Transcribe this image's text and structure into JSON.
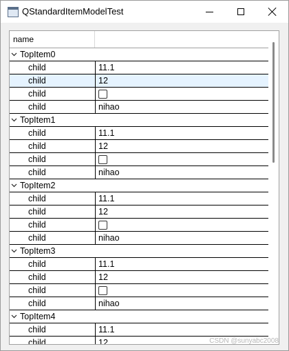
{
  "window": {
    "title": "QStandardItemModelTest"
  },
  "tree": {
    "header": "name",
    "groups": [
      {
        "label": "TopItem0",
        "children": [
          {
            "name": "child",
            "value": "11.1",
            "kind": "text"
          },
          {
            "name": "child",
            "value": "12",
            "kind": "text",
            "selected": true
          },
          {
            "name": "child",
            "value": "",
            "kind": "checkbox"
          },
          {
            "name": "child",
            "value": "nihao",
            "kind": "text"
          }
        ]
      },
      {
        "label": "TopItem1",
        "children": [
          {
            "name": "child",
            "value": "11.1",
            "kind": "text"
          },
          {
            "name": "child",
            "value": "12",
            "kind": "text"
          },
          {
            "name": "child",
            "value": "",
            "kind": "checkbox"
          },
          {
            "name": "child",
            "value": "nihao",
            "kind": "text"
          }
        ]
      },
      {
        "label": "TopItem2",
        "children": [
          {
            "name": "child",
            "value": "11.1",
            "kind": "text"
          },
          {
            "name": "child",
            "value": "12",
            "kind": "text"
          },
          {
            "name": "child",
            "value": "",
            "kind": "checkbox"
          },
          {
            "name": "child",
            "value": "nihao",
            "kind": "text"
          }
        ]
      },
      {
        "label": "TopItem3",
        "children": [
          {
            "name": "child",
            "value": "11.1",
            "kind": "text"
          },
          {
            "name": "child",
            "value": "12",
            "kind": "text"
          },
          {
            "name": "child",
            "value": "",
            "kind": "checkbox"
          },
          {
            "name": "child",
            "value": "nihao",
            "kind": "text"
          }
        ]
      },
      {
        "label": "TopItem4",
        "children": [
          {
            "name": "child",
            "value": "11.1",
            "kind": "text"
          },
          {
            "name": "child",
            "value": "12",
            "kind": "text"
          }
        ]
      }
    ]
  },
  "watermark": "CSDN @sunyabc2008",
  "colors": {
    "selection": "#e5f3ff",
    "grid": "#000000",
    "scroll_thumb": "#8a8a8a"
  },
  "icons": {
    "app": "window-app-icon",
    "expander": "chevron-down-icon"
  }
}
